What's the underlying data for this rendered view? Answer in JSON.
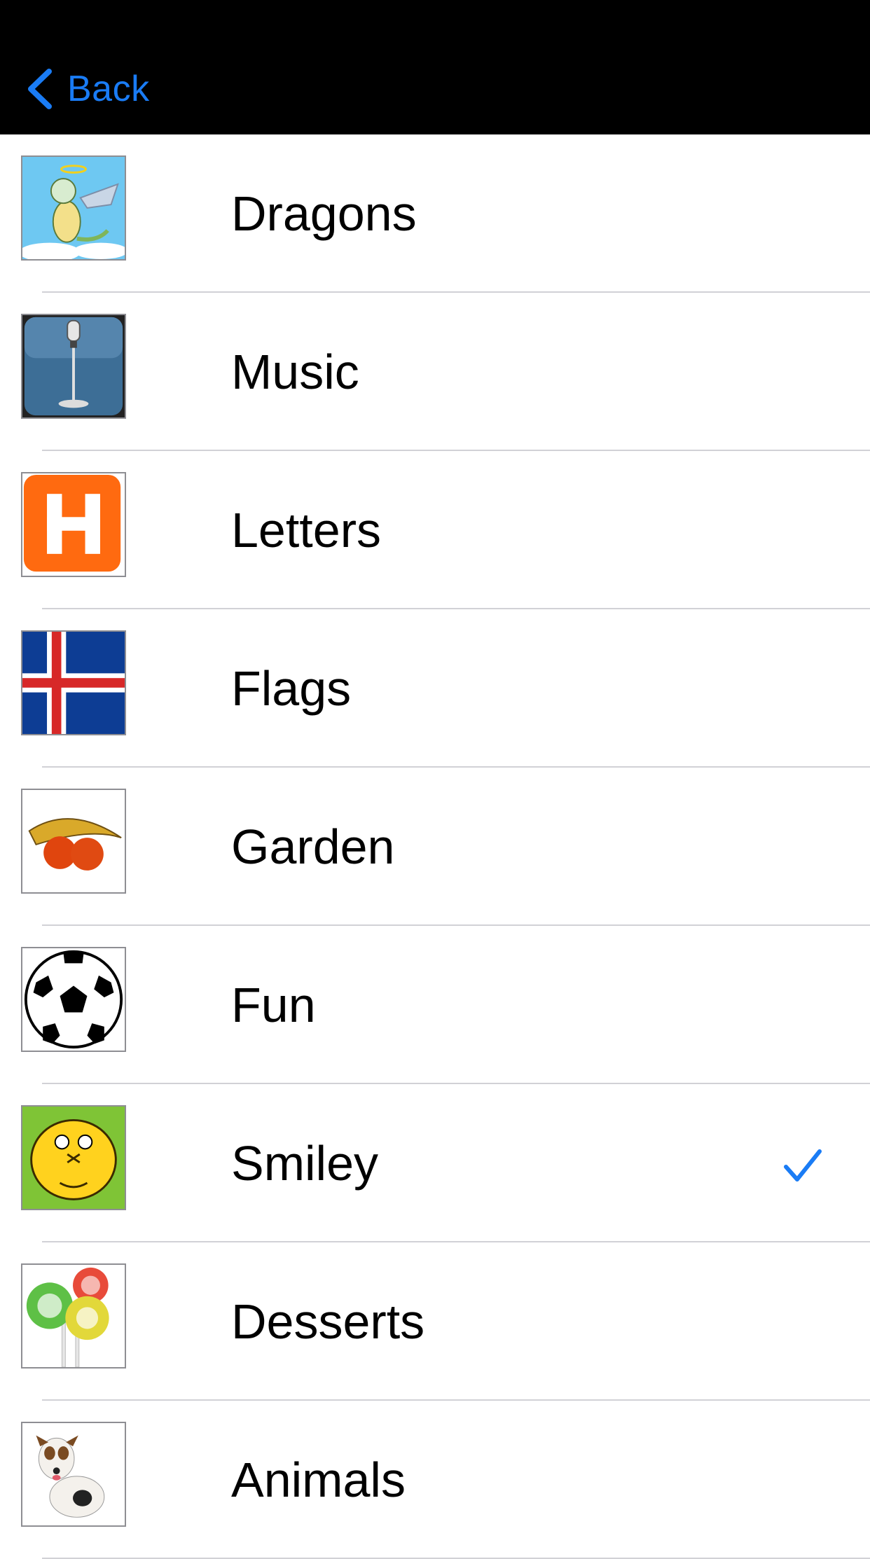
{
  "nav": {
    "back_label": "Back",
    "accent_color": "#1a7cf5"
  },
  "categories": [
    {
      "label": "Dragons",
      "icon": "dragon-icon",
      "selected": false
    },
    {
      "label": "Music",
      "icon": "microphone-icon",
      "selected": false
    },
    {
      "label": "Letters",
      "icon": "letter-h-icon",
      "selected": false
    },
    {
      "label": "Flags",
      "icon": "flag-icon",
      "selected": false
    },
    {
      "label": "Garden",
      "icon": "fruit-icon",
      "selected": false
    },
    {
      "label": "Fun",
      "icon": "soccer-ball-icon",
      "selected": false
    },
    {
      "label": "Smiley",
      "icon": "smiley-icon",
      "selected": true
    },
    {
      "label": "Desserts",
      "icon": "lollipop-icon",
      "selected": false
    },
    {
      "label": "Animals",
      "icon": "dog-icon",
      "selected": false
    }
  ]
}
